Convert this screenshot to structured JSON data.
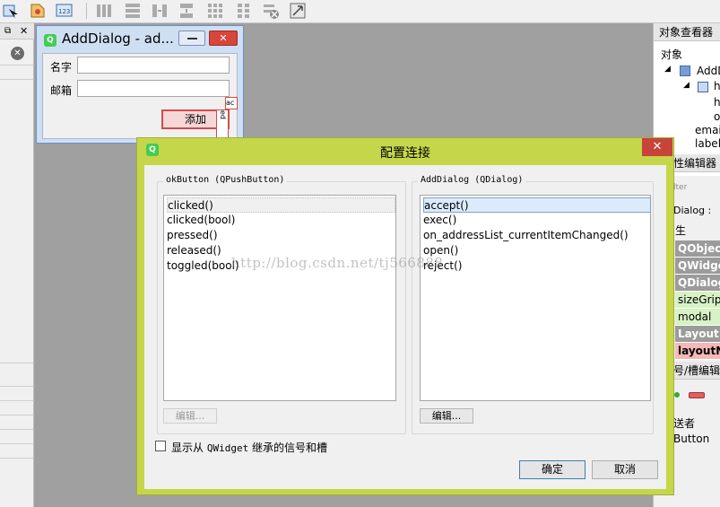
{
  "form_preview": {
    "title": "AddDialog - ad...",
    "name_label": "名字",
    "email_label": "邮箱",
    "add_button": "添加",
    "fragment_ac": "ac",
    "fragment_ed": "ed"
  },
  "dialog": {
    "title": "配置连接",
    "close_glyph": "✕",
    "sender_group": "okButton (QPushButton)",
    "receiver_group": "AddDialog (QDialog)",
    "signals": [
      "clicked()",
      "clicked(bool)",
      "pressed()",
      "released()",
      "toggled(bool)"
    ],
    "slots": [
      "accept()",
      "exec()",
      "on_addressList_currentItemChanged()",
      "open()",
      "reject()"
    ],
    "edit_label": "编辑...",
    "inherit_prefix": "显示从 ",
    "inherit_class": "QWidget",
    "inherit_suffix": " 继承的信号和槽",
    "ok_label": "确定",
    "cancel_label": "取消"
  },
  "right_dock": {
    "object_inspector_title": "对象查看器",
    "object_header": "对象",
    "tree_1": "AddD",
    "tree_2": "h",
    "tree_3": "h",
    "tree_4": "o",
    "tree_5": "emai",
    "tree_6": "label",
    "property_editor_title": "性编辑器",
    "filter_placeholder": "lter",
    "dialog_label": "Dialog :",
    "property_header": "生",
    "properties": [
      "QObject",
      "QWidge",
      "QDialog",
      "sizeGrip",
      "modal",
      "Layout",
      "layoutN"
    ],
    "signal_slot_title": "号/槽编辑器",
    "sender_label": "送者",
    "button_label": "Button"
  },
  "watermark": "http://blog.csdn.net/tj566888",
  "colors": {
    "dialog_frame": "#c6d64a",
    "close_button": "#c7443a",
    "selection": "#dcebfc",
    "prop_gray": "#9b9b9b",
    "prop_green": "#d7f2c4",
    "prop_red": "#f5b7b7"
  }
}
